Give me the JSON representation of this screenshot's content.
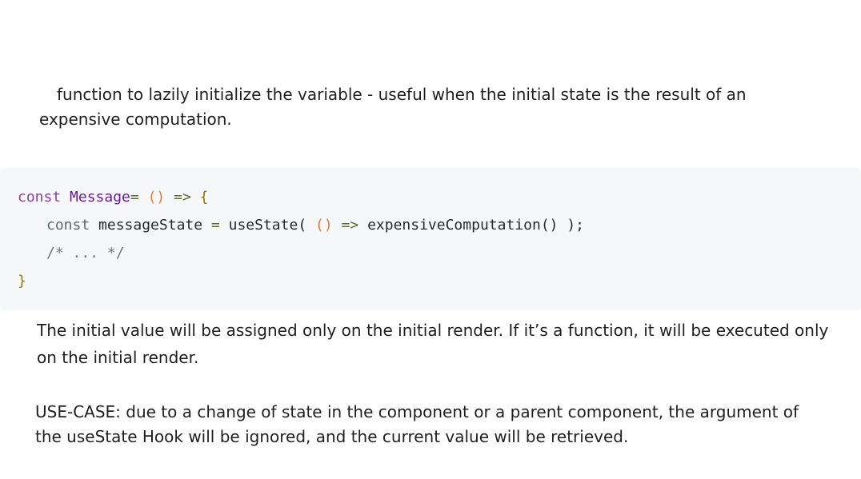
{
  "intro": {
    "line1": "function to lazily initialize the variable - useful when the initial state is the result of an",
    "line2": "expensive computation."
  },
  "code": {
    "line1": {
      "keyword": "const",
      "name": "Message",
      "assign": "=",
      "parens": "()",
      "arrow": "=>",
      "brace_open": "{"
    },
    "line2": {
      "keyword": "const",
      "variable": "messageState",
      "assign": "=",
      "hook": "useState",
      "open": "(",
      "parens": "()",
      "arrow": "=>",
      "call": "expensiveComputation",
      "call_parens": "()",
      "close": ");"
    },
    "line3": {
      "comment": "/* ... */"
    },
    "line4": {
      "brace_close": "}"
    }
  },
  "note": {
    "line1": "The initial value will be assigned only on the initial render. If it’s a function, it will be executed only",
    "line2": "on the initial render."
  },
  "usecase": {
    "line1": "USE-CASE: due to a change of state in the component or a parent component, the argument of",
    "line2": "the useState Hook will be ignored, and the current value will be retrieved."
  }
}
